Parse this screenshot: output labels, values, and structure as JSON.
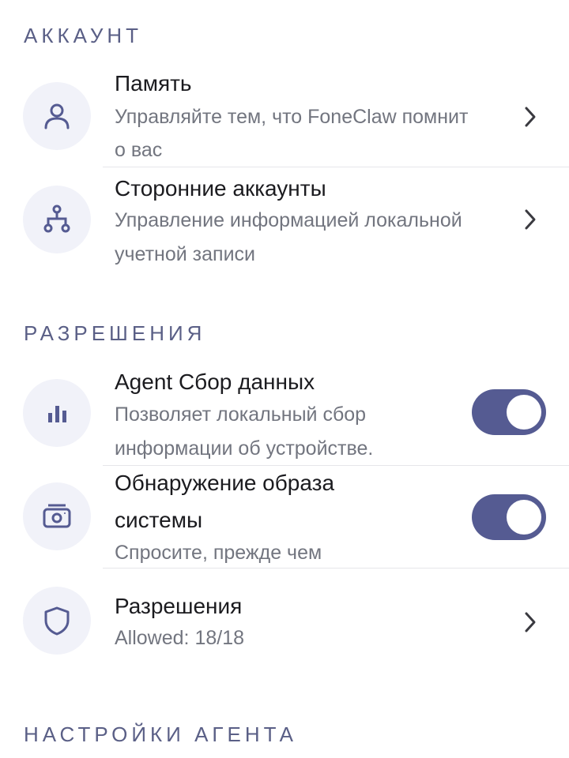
{
  "sections": {
    "account": "АККАУНТ",
    "permissions": "РАЗРЕШЕНИЯ",
    "agent_settings": "НАСТРОЙКИ АГЕНТА"
  },
  "account_items": [
    {
      "title": "Память",
      "desc_line1": "Управляйте тем, что FoneClaw помнит",
      "desc_line2": "о вас",
      "icon": "person-icon"
    },
    {
      "title": "Сторонние аккаунты",
      "desc_line1": "Управление информацией локальной",
      "desc_line2": "учетной записи",
      "icon": "hierarchy-icon"
    }
  ],
  "permission_items": [
    {
      "title": "Agent Сбор данных",
      "desc_line1": "Позволяет локальный сбор",
      "desc_line2": "информации об устройстве.",
      "icon": "bar-chart-icon",
      "toggle_on": true
    },
    {
      "title_line1": "Обнаружение образа",
      "title_line2": "системы",
      "desc": "Спросите, прежде чем",
      "icon": "camera-icon",
      "toggle_on": true
    },
    {
      "title": "Разрешения",
      "desc": "Allowed: 18/18",
      "icon": "shield-icon"
    }
  ],
  "colors": {
    "accent": "#555b92",
    "section_title": "#5a5f86",
    "icon_bg": "#f1f2f9",
    "secondary_text": "#72757f"
  }
}
